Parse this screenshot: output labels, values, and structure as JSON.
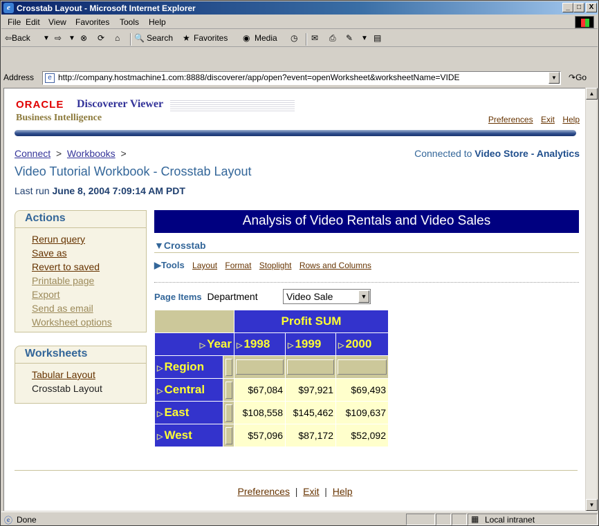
{
  "window": {
    "title": "Crosstab Layout - Microsoft Internet Explorer",
    "min": "_",
    "max": "□",
    "close": "X"
  },
  "menu": [
    "File",
    "Edit",
    "View",
    "Favorites",
    "Tools",
    "Help"
  ],
  "toolbar": {
    "back": "⇦Back",
    "search": "Search",
    "favorites": "Favorites",
    "media": "Media"
  },
  "address": {
    "label": "Address",
    "url": "http://company.hostmachine1.com:8888/discoverer/app/open?event=openWorksheet&worksheetName=VIDE",
    "go": "Go"
  },
  "header": {
    "oracle": "ORACLE",
    "product": "Discoverer Viewer",
    "subtitle": "Business Intelligence",
    "links": [
      "Preferences",
      "Exit",
      "Help"
    ]
  },
  "breadcrumb": {
    "connect": "Connect",
    "sep": ">",
    "workbooks": "Workbooks",
    "sep2": ">"
  },
  "connection": {
    "prefix": "Connected to",
    "name": "Video Store - Analytics"
  },
  "worksheet_title": "Video Tutorial Workbook - Crosstab Layout",
  "last_run": {
    "prefix": "Last run",
    "value": "June 8, 2004 7:09:14 AM PDT"
  },
  "actions": {
    "title": "Actions",
    "items": [
      "Rerun query",
      "Save as",
      "Revert to saved",
      "Printable page",
      "Export",
      "Send as email",
      "Worksheet options"
    ]
  },
  "worksheets": {
    "title": "Worksheets",
    "items": [
      "Tabular Layout",
      "Crosstab Layout"
    ]
  },
  "banner": "Analysis of Video Rentals and Video Sales",
  "crosstab_label": "Crosstab",
  "tools": {
    "label": "Tools",
    "links": [
      "Layout",
      "Format",
      "Stoplight",
      "Rows and Columns"
    ]
  },
  "page_items": {
    "label": "Page Items",
    "item": "Department",
    "value": "Video Sale"
  },
  "crosstab": {
    "measure": "Profit SUM",
    "col_dim": "Year",
    "row_dim": "Region",
    "years": [
      "1998",
      "1999",
      "2000"
    ],
    "rows": [
      {
        "region": "Central",
        "values": [
          "$67,084",
          "$97,921",
          "$69,493"
        ]
      },
      {
        "region": "East",
        "values": [
          "$108,558",
          "$145,462",
          "$109,637"
        ]
      },
      {
        "region": "West",
        "values": [
          "$57,096",
          "$87,172",
          "$52,092"
        ]
      }
    ]
  },
  "footer": {
    "links": [
      "Preferences",
      "Exit",
      "Help"
    ],
    "sep": "|"
  },
  "status": {
    "text": "Done",
    "zone": "Local intranet"
  }
}
